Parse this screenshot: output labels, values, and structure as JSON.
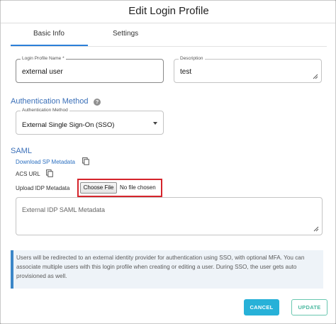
{
  "dialog": {
    "title": "Edit Login Profile",
    "tabs": [
      {
        "label": "Basic Info",
        "active": true
      },
      {
        "label": "Settings",
        "active": false
      }
    ]
  },
  "form": {
    "profile_name": {
      "label": "Login Profile Name *",
      "value": "external user"
    },
    "description": {
      "label": "Description",
      "value": "test"
    },
    "auth_section_title": "Authentication Method",
    "auth_method": {
      "label": "Authentication Method",
      "value": "External Single Sign-On (SSO)"
    },
    "saml_section_title": "SAML",
    "download_sp_metadata": "Download SP Metadata",
    "acs_url_label": "ACS URL",
    "upload_idp_label": "Upload IDP Metadata",
    "choose_file_label": "Choose File",
    "no_file_text": "No file chosen",
    "idp_metadata_placeholder": "External IDP SAML Metadata"
  },
  "info_message": "Users will be redirected to an external identity provider for authentication using SSO, with optional MFA. You can associate multiple users with this login profile when creating or editing a user. During SSO, the user gets auto provisioned as well.",
  "buttons": {
    "cancel": "CANCEL",
    "update": "UPDATE"
  },
  "colors": {
    "accent": "#2b7fd9",
    "cancel_bg": "#27b1d8",
    "update_text": "#4ab9a0",
    "highlight": "#d5242b"
  }
}
